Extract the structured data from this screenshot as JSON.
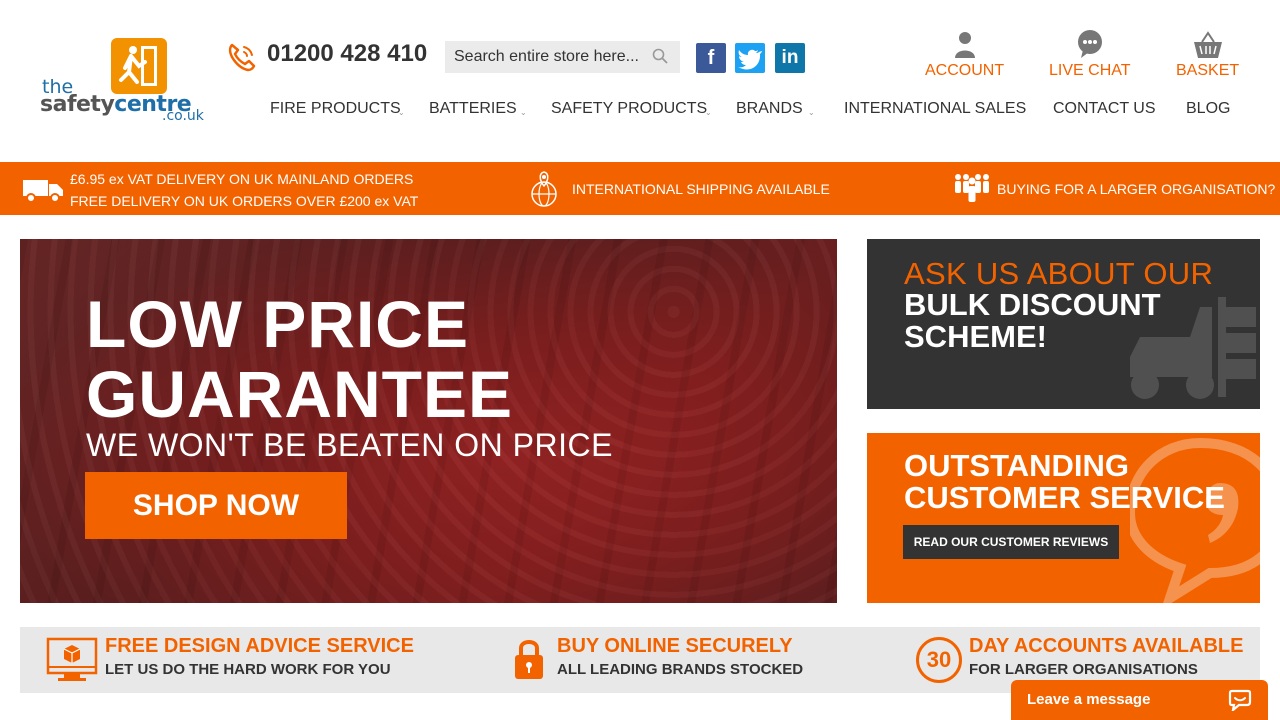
{
  "header": {
    "logo": {
      "line1": "the",
      "line2a": "safety",
      "line2b": "centre",
      "line3": ".co.uk"
    },
    "phone": "01200 428 410",
    "search_placeholder": "Search entire store here...",
    "social": [
      "facebook",
      "twitter",
      "linkedin"
    ],
    "account_label": "ACCOUNT",
    "live_chat_label": "LIVE CHAT",
    "basket_label": "BASKET"
  },
  "nav": {
    "items": [
      {
        "label": "FIRE PRODUCTS",
        "has_dropdown": true
      },
      {
        "label": "BATTERIES",
        "has_dropdown": true
      },
      {
        "label": "SAFETY PRODUCTS",
        "has_dropdown": true
      },
      {
        "label": "BRANDS",
        "has_dropdown": true
      },
      {
        "label": "INTERNATIONAL SALES",
        "has_dropdown": false
      },
      {
        "label": "CONTACT US",
        "has_dropdown": false
      },
      {
        "label": "BLOG",
        "has_dropdown": false
      }
    ]
  },
  "info_bar": {
    "delivery_line1": "£6.95 ex VAT DELIVERY ON UK MAINLAND ORDERS",
    "delivery_line2": "FREE DELIVERY ON UK ORDERS OVER £200 ex VAT",
    "international": "INTERNATIONAL SHIPPING AVAILABLE",
    "organisation": "BUYING FOR A LARGER ORGANISATION?"
  },
  "hero": {
    "title_line1": "LOW PRICE",
    "title_line2": "GUARANTEE",
    "subtitle": "WE WON'T BE BEATEN ON PRICE",
    "cta": "SHOP NOW"
  },
  "panels": {
    "bulk": {
      "line1": "ASK US ABOUT OUR",
      "line2": "BULK DISCOUNT SCHEME!"
    },
    "service": {
      "line1": "OUTSTANDING CUSTOMER SERVICE",
      "button": "READ OUR CUSTOMER REVIEWS"
    }
  },
  "features": [
    {
      "title": "FREE DESIGN ADVICE SERVICE",
      "subtitle": "LET US DO THE HARD WORK FOR YOU",
      "icon": "monitor-box-icon"
    },
    {
      "title": "BUY ONLINE SECURELY",
      "subtitle": "ALL LEADING BRANDS STOCKED",
      "icon": "padlock-icon"
    },
    {
      "title": "DAY ACCOUNTS AVAILABLE",
      "subtitle": "FOR LARGER ORGANISATIONS",
      "icon": "thirty-days-icon",
      "icon_text": "30"
    }
  ],
  "chat_widget": {
    "label": "Leave a message"
  },
  "colors": {
    "accent": "#f26300",
    "dark": "#333333",
    "logo_orange": "#f39200",
    "logo_blue": "#1e6fa8"
  }
}
